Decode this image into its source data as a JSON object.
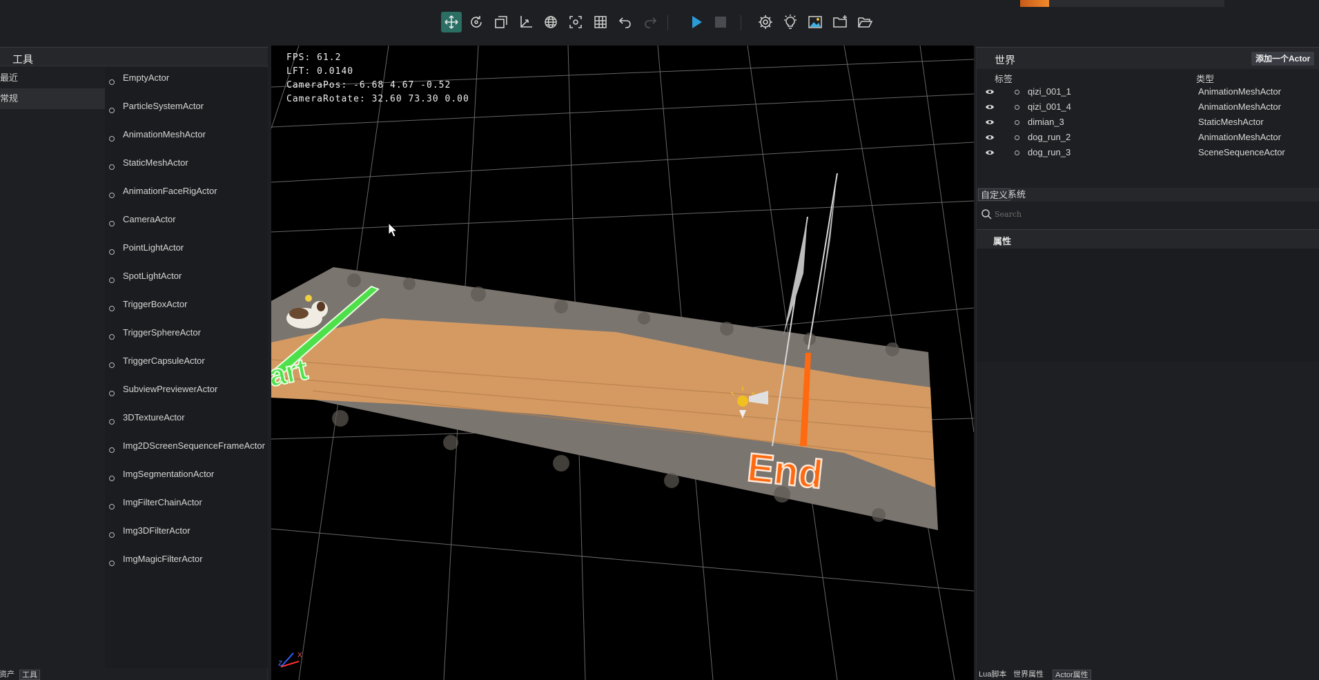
{
  "toolbar": {
    "icons": [
      "move-icon",
      "rotate-icon",
      "scale-icon",
      "axis-icon",
      "globe-icon",
      "focus-icon",
      "grid-icon",
      "undo-icon",
      "redo-icon",
      "play-icon",
      "stop-icon",
      "settings-icon",
      "light-icon",
      "image-icon",
      "folder-add-icon",
      "folder-open-icon"
    ]
  },
  "left_panel": {
    "title": "工具",
    "categories": [
      {
        "label": "最近"
      },
      {
        "label": "常规"
      }
    ],
    "actors": [
      {
        "label": "EmptyActor"
      },
      {
        "label": "ParticleSystemActor"
      },
      {
        "label": "AnimationMeshActor"
      },
      {
        "label": "StaticMeshActor"
      },
      {
        "label": "AnimationFaceRigActor"
      },
      {
        "label": "CameraActor"
      },
      {
        "label": "PointLightActor"
      },
      {
        "label": "SpotLightActor"
      },
      {
        "label": "TriggerBoxActor"
      },
      {
        "label": "TriggerSphereActor"
      },
      {
        "label": "TriggerCapsuleActor"
      },
      {
        "label": "SubviewPreviewerActor"
      },
      {
        "label": "3DTextureActor"
      },
      {
        "label": "Img2DScreenSequenceFrameActor"
      },
      {
        "label": "ImgSegmentationActor"
      },
      {
        "label": "ImgFilterChainActor"
      },
      {
        "label": "Img3DFilterActor"
      },
      {
        "label": "ImgMagicFilterActor"
      }
    ],
    "bottom_tabs": [
      "资产",
      "工具"
    ]
  },
  "viewport": {
    "fps": "FPS: 61.2",
    "lft": "LFT: 0.0140",
    "camera_pos": "CameraPos: -6.68 4.67 -0.52",
    "camera_rotate": "CameraRotate: 32.60 73.30 0.00",
    "start_label": "art",
    "end_label": "End",
    "axis_x": "X",
    "axis_z": "Z"
  },
  "right_panel": {
    "world_title": "世界",
    "add_actor_label": "添加一个Actor",
    "col_tag": "标签",
    "col_type": "类型",
    "rows": [
      {
        "name": "qizi_001_1",
        "type": "AnimationMeshActor"
      },
      {
        "name": "qizi_001_4",
        "type": "AnimationMeshActor"
      },
      {
        "name": "dimian_3",
        "type": "StaticMeshActor"
      },
      {
        "name": "dog_run_2",
        "type": "AnimationMeshActor"
      },
      {
        "name": "dog_run_3",
        "type": "SceneSequenceActor"
      }
    ],
    "prop_tabs": [
      "自定义",
      "系统"
    ],
    "search_placeholder": "Search",
    "attr_title": "属性",
    "bottom_tabs": [
      "Lua脚本",
      "世界属性",
      "Actor属性"
    ]
  },
  "colors": {
    "accent": "#2a6e64",
    "play": "#2b9bd8",
    "end_orange": "#ff6a10",
    "start_green": "#4ee04a"
  }
}
